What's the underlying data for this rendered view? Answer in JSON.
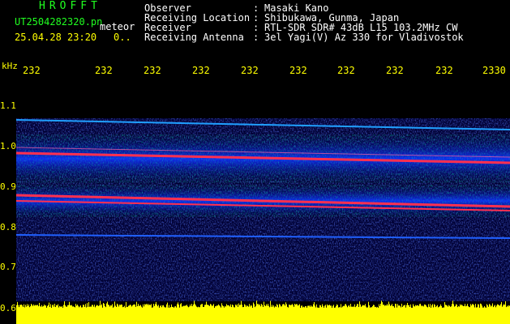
{
  "app": {
    "title": "HROFFT",
    "filename": "UT2504282320.pn",
    "mode": "meteor",
    "datetime": "25.04.28 23:20",
    "extra": "0.."
  },
  "station": {
    "labels": [
      "Observer",
      "Receiving Location",
      "Receiver",
      "Receiving Antenna"
    ],
    "values": [
      "Masaki Kano",
      "Shibukawa, Gunma, Japan",
      "RTL-SDR SDR# 43dB L15 103.2MHz CW",
      "3el Yagi(V) Az 330 for Vladivostok"
    ]
  },
  "axis": {
    "freq_unit": "kHz",
    "freq_ticks": [
      "1.1",
      "1.0",
      "0.9",
      "0.8",
      "0.7",
      "0.6"
    ],
    "time_ticks": [
      "232",
      "232",
      "232",
      "232",
      "232",
      "232",
      "232",
      "232",
      "232",
      "2330"
    ]
  },
  "colors": {
    "background": "#000000",
    "header_green": "#20ff20",
    "header_white": "#ffffff",
    "axis_yellow": "#ffff00",
    "noise_blue": "#1a33ff",
    "band_red": "#ff3050",
    "level_yellow": "#ffff00"
  }
}
